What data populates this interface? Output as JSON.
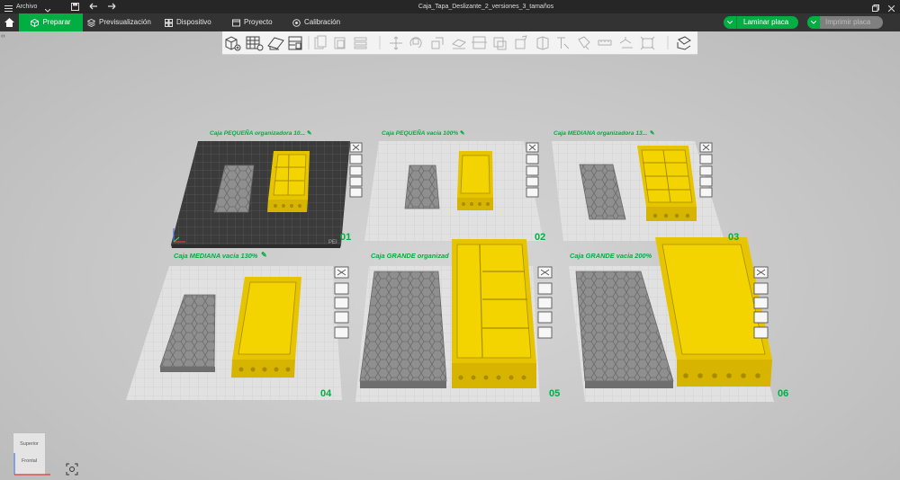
{
  "window": {
    "menu_label": "Archivo",
    "title": "Caja_Tapa_Deslizante_2_versiones_3_tamaños"
  },
  "tabs": [
    {
      "label": "Preparar",
      "icon": "cube-icon",
      "active": true
    },
    {
      "label": "Previsualización",
      "icon": "layers-icon"
    },
    {
      "label": "Dispositivo",
      "icon": "device-icon"
    },
    {
      "label": "Proyecto",
      "icon": "project-icon"
    },
    {
      "label": "Calibración",
      "icon": "calibration-icon"
    }
  ],
  "actions": {
    "slice_label": "Laminar placa",
    "print_label": "Imprimir placa"
  },
  "plates": [
    {
      "title": "Caja PEQUEÑA organizadora 10...",
      "number": "01",
      "active": true,
      "bed_text": "PEI"
    },
    {
      "title": "Caja PEQUEÑA vacia 100%",
      "number": "02"
    },
    {
      "title": "Caja MEDIANA organizadora 13...",
      "number": "03"
    },
    {
      "title": "Caja MEDIANA vacia 130%",
      "number": "04"
    },
    {
      "title": "Caja GRANDE organizad",
      "number": "05"
    },
    {
      "title": "Caja GRANDE vacia 200%",
      "number": "06"
    }
  ],
  "view_cube": {
    "top_label": "Superior",
    "front_label": "Frontal"
  },
  "colors": {
    "accent": "#00ae42",
    "filament": "#f2d000",
    "base_gray": "#8c8c8c"
  }
}
